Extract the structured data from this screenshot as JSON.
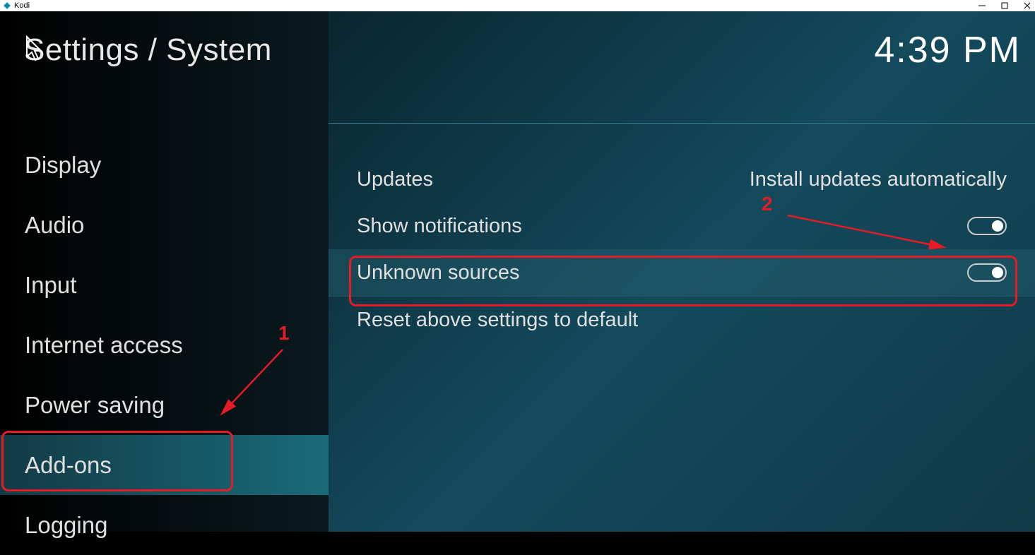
{
  "titlebar": {
    "app_name": "Kodi"
  },
  "header": {
    "title": "Settings / System",
    "clock": "4:39 PM"
  },
  "sidebar": {
    "items": [
      {
        "label": "Display",
        "active": false
      },
      {
        "label": "Audio",
        "active": false
      },
      {
        "label": "Input",
        "active": false
      },
      {
        "label": "Internet access",
        "active": false
      },
      {
        "label": "Power saving",
        "active": false
      },
      {
        "label": "Add-ons",
        "active": true
      },
      {
        "label": "Logging",
        "active": false
      }
    ]
  },
  "settings": {
    "updates": {
      "label": "Updates",
      "value": "Install updates automatically"
    },
    "show_notifications": {
      "label": "Show notifications",
      "toggle": true
    },
    "unknown_sources": {
      "label": "Unknown sources",
      "toggle": true
    },
    "reset": {
      "label": "Reset above settings to default"
    }
  },
  "annotations": {
    "label1": "1",
    "label2": "2"
  }
}
